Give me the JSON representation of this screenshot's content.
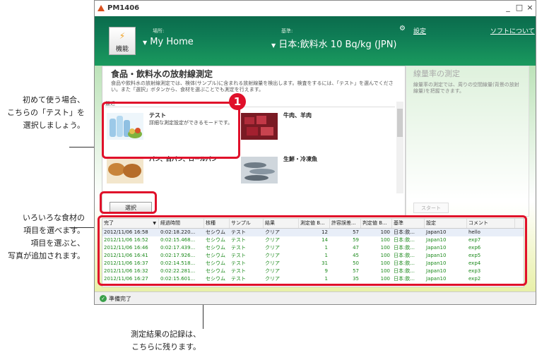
{
  "callouts": {
    "first_time": [
      "初めて使う場合、",
      "こちらの「テスト」を",
      "選択しましょう。"
    ],
    "food_select": [
      "いろいろな食材の",
      "項目を選べます。",
      "項目を選ぶと、",
      "写真が追加されます。"
    ],
    "results": [
      "測定結果の記録は、",
      "こちらに残ります。"
    ],
    "badge_number": "1"
  },
  "window": {
    "title": "PM1406",
    "minimize": "_",
    "maximize": "□",
    "close": "×"
  },
  "header": {
    "func_button": "機能",
    "location_label": "場所:",
    "location_value": "My Home",
    "standard_label": "基準:",
    "standard_value": "日本:飲料水 10 Bq/kg (JPN)",
    "settings_link": "設定",
    "about_link": "ソフトについて"
  },
  "food_panel": {
    "title": "食品・飲料水の放射線測定",
    "description": "食品や飲料水の放射線測定では、検体(サンプル)に含まれる放射線量を検出します。検査をするには、「テスト」を選んでください。また「選択」ボタンから、食材を選ぶことでも測定を行えます。",
    "recent_label": "最近",
    "items": [
      {
        "name": "テスト",
        "sub": "詳細な測定設定ができるモードです。"
      },
      {
        "name": "牛肉、羊肉",
        "sub": ""
      },
      {
        "name": "パン、白パン、ロールパン",
        "sub": ""
      },
      {
        "name": "生鮮・冷凍魚",
        "sub": ""
      }
    ],
    "select_button": "選択"
  },
  "dose_panel": {
    "title": "線量率の測定",
    "description": "線量率の測定では、周りの空間線量(背景の放射線量)を把握できます。",
    "start_button": "スタート"
  },
  "table": {
    "columns": [
      "完了",
      "経過時間",
      "核種",
      "サンプル",
      "結果",
      "測定値 B...",
      "許容誤差...",
      "判定値 B...",
      "基準",
      "設定",
      "コメント"
    ],
    "rows": [
      [
        "2012/11/06 16:58",
        "0:02:18.220...",
        "セシウム",
        "テスト",
        "クリア",
        "12",
        "57",
        "100",
        "日本:飲...",
        "Japan10",
        "hello"
      ],
      [
        "2012/11/06 16:52",
        "0:02:15.468...",
        "セシウム",
        "テスト",
        "クリア",
        "14",
        "59",
        "100",
        "日本:飲...",
        "Japan10",
        "exp7"
      ],
      [
        "2012/11/06 16:46",
        "0:02:17.439...",
        "セシウム",
        "テスト",
        "クリア",
        "1",
        "47",
        "100",
        "日本:飲...",
        "Japan10",
        "exp6"
      ],
      [
        "2012/11/06 16:41",
        "0:02:17.926...",
        "セシウム",
        "テスト",
        "クリア",
        "1",
        "45",
        "100",
        "日本:飲...",
        "Japan10",
        "exp5"
      ],
      [
        "2012/11/06 16:37",
        "0:02:14.518...",
        "セシウム",
        "テスト",
        "クリア",
        "31",
        "50",
        "100",
        "日本:飲...",
        "Japan10",
        "exp4"
      ],
      [
        "2012/11/06 16:32",
        "0:02:22.281...",
        "セシウム",
        "テスト",
        "クリア",
        "9",
        "57",
        "100",
        "日本:飲...",
        "Japan10",
        "exp3"
      ],
      [
        "2012/11/06 16:27",
        "0:02:15.601...",
        "セシウム",
        "テスト",
        "クリア",
        "1",
        "35",
        "100",
        "日本:飲...",
        "Japan10",
        "exp2"
      ]
    ]
  },
  "status": {
    "text": "準備完了"
  },
  "colors": {
    "highlight": "#e0102a",
    "header_green": "#0f7c55",
    "row_green": "#1c8a1c"
  }
}
